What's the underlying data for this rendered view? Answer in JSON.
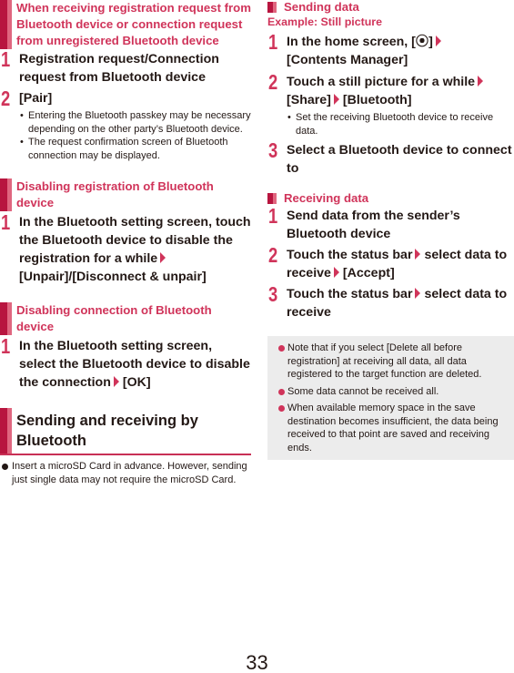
{
  "left": {
    "section1": {
      "title": "When receiving registration request from Bluetooth device or connection request from unregistered Bluetooth device",
      "steps": [
        {
          "num": "1",
          "text": "Registration request/Connection request from Bluetooth device"
        },
        {
          "num": "2",
          "text": "[Pair]"
        }
      ],
      "notes": [
        "Entering the Bluetooth passkey may be necessary depending on the other party’s Bluetooth device.",
        "The request confirmation screen of Bluetooth connection may be displayed."
      ]
    },
    "section2": {
      "title": "Disabling registration of Bluetooth device",
      "step": {
        "num": "1",
        "text_a": "In the Bluetooth setting screen, touch the Bluetooth device to disable the registration for a while",
        "text_b": "[Unpair]/[Disconnect & unpair]"
      }
    },
    "section3": {
      "title": "Disabling connection of Bluetooth device",
      "step": {
        "num": "1",
        "text_a": "In the Bluetooth setting screen, select the Bluetooth device to disable the connection",
        "text_b": "[OK]"
      }
    },
    "section4": {
      "title": "Sending and receiving by Bluetooth",
      "note": "Insert a microSD Card in advance. However, sending just single data may not require the microSD Card."
    }
  },
  "right": {
    "sending": {
      "title": "Sending data",
      "example": "Example: Still picture",
      "step1": {
        "num": "1",
        "text_a": "In the home screen, [⦿]",
        "text_b": "[Contents Manager]"
      },
      "step2": {
        "num": "2",
        "text_a": "Touch a still picture for a while",
        "text_b": "[Share]",
        "text_c": "[Bluetooth]"
      },
      "step2_note": "Set the receiving Bluetooth device to receive data.",
      "step3": {
        "num": "3",
        "text": "Select a Bluetooth device to connect to"
      }
    },
    "receiving": {
      "title": "Receiving data",
      "step1": {
        "num": "1",
        "text": "Send data from the sender’s Bluetooth device"
      },
      "step2": {
        "num": "2",
        "text_a": "Touch the status bar",
        "text_b": "select data to receive",
        "text_c": "[Accept]"
      },
      "step3": {
        "num": "3",
        "text_a": "Touch the status bar",
        "text_b": "select data to receive"
      }
    },
    "notes": [
      "Note that if you select [Delete all before registration] at receiving all data, all data registered to the target function are deleted.",
      "Some data cannot be received all.",
      "When available memory space in the save destination becomes insufficient, the data being received to that point are saved and receiving ends."
    ]
  },
  "page_number": "33",
  "colors": {
    "accent": "#d0345a",
    "bar_dark": "#b8153f",
    "bar_light": "#e0667f",
    "note_bg": "#ececec"
  }
}
